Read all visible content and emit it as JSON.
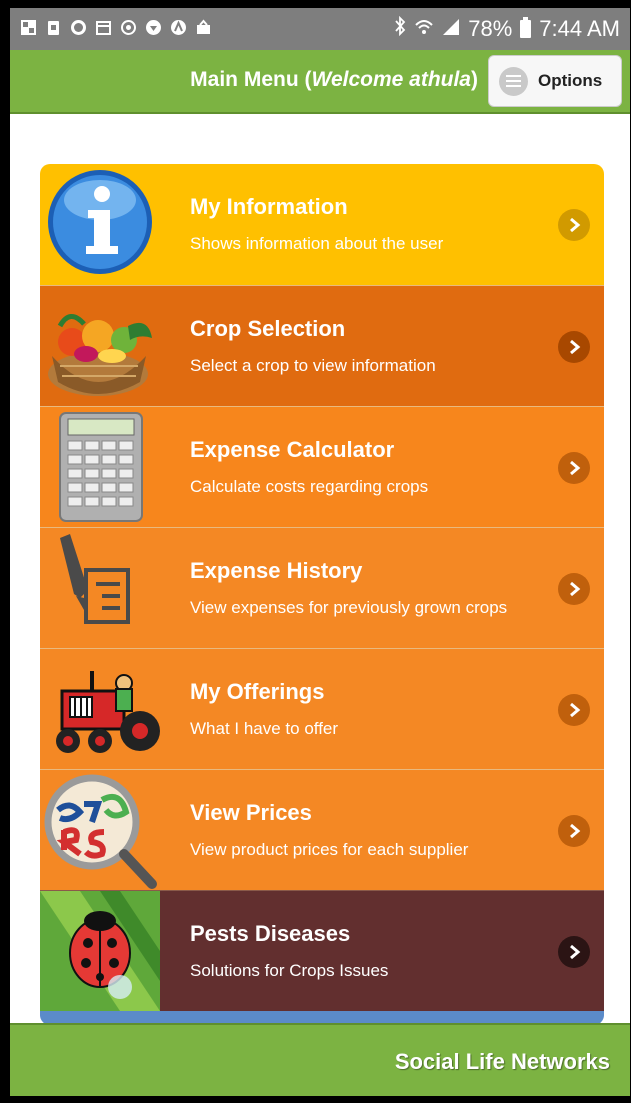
{
  "status_bar": {
    "battery": "78%",
    "time": "7:44 AM",
    "icons": [
      "gallery-icon",
      "clipboard-icon",
      "wordpress-icon",
      "calendar-icon",
      "sync-icon",
      "shield-icon",
      "acrobat-icon",
      "inbox-icon"
    ],
    "right_icons": [
      "bluetooth-icon",
      "wifi-icon",
      "signal-icon",
      "battery-icon"
    ]
  },
  "header": {
    "title_prefix": "Main Menu (",
    "title_italic": "Welcome athula",
    "title_suffix": ")",
    "options_label": "Options",
    "color": "#7cb342"
  },
  "menu": {
    "items": [
      {
        "title": "My Information",
        "subtitle": "Shows information about the user",
        "bg": "#ffc000",
        "icon": "info-icon"
      },
      {
        "title": "Crop Selection",
        "subtitle": "Select a crop to view information",
        "bg": "#e06b10",
        "icon": "vegetable-basket-icon"
      },
      {
        "title": "Expense Calculator",
        "subtitle": "Calculate costs regarding crops",
        "bg": "#f7861c",
        "icon": "calculator-icon"
      },
      {
        "title": "Expense History",
        "subtitle": "View expenses for previously grown crops",
        "bg": "#f48824",
        "icon": "pen-document-icon"
      },
      {
        "title": "My Offerings",
        "subtitle": "What I have to offer",
        "bg": "#f48824",
        "icon": "tractor-icon"
      },
      {
        "title": "View Prices",
        "subtitle": "View product prices for each supplier",
        "bg": "#f48824",
        "icon": "price-magnifier-icon"
      },
      {
        "title": "Pests Diseases",
        "subtitle": "Solutions for Crops Issues",
        "bg": "#622f2f",
        "icon": "ladybug-icon"
      }
    ]
  },
  "footer": {
    "text": "Social Life Networks"
  }
}
